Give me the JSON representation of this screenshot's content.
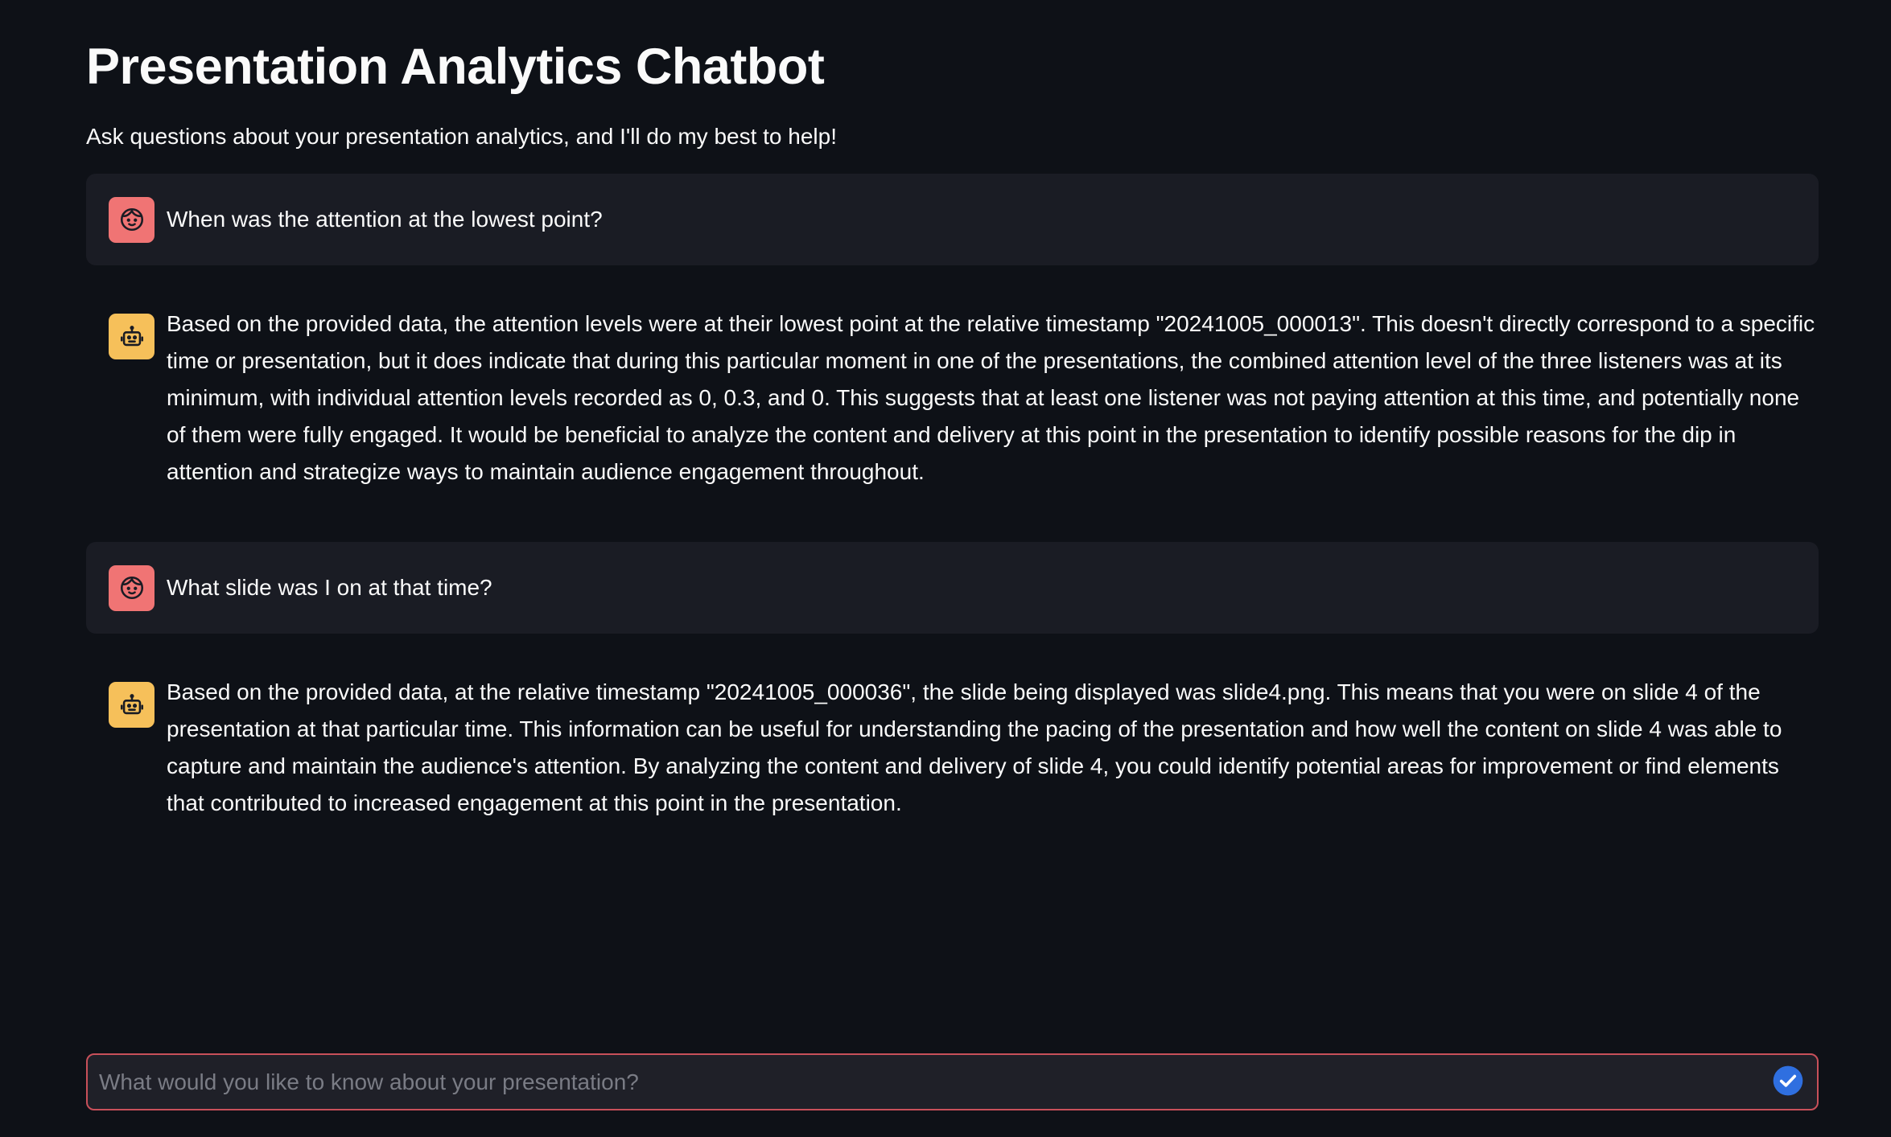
{
  "page": {
    "title": "Presentation Analytics Chatbot",
    "subtitle": "Ask questions about your presentation analytics, and I'll do my best to help!"
  },
  "messages": [
    {
      "role": "user",
      "avatar_icon": "user-face-icon",
      "text": "When was the attention at the lowest point?"
    },
    {
      "role": "assistant",
      "avatar_icon": "robot-icon",
      "text": "Based on the provided data, the attention levels were at their lowest point at the relative timestamp \"20241005_000013\". This doesn't directly correspond to a specific time or presentation, but it does indicate that during this particular moment in one of the presentations, the combined attention level of the three listeners was at its minimum, with individual attention levels recorded as 0, 0.3, and 0. This suggests that at least one listener was not paying attention at this time, and potentially none of them were fully engaged. It would be beneficial to analyze the content and delivery at this point in the presentation to identify possible reasons for the dip in attention and strategize ways to maintain audience engagement throughout."
    },
    {
      "role": "user",
      "avatar_icon": "user-face-icon",
      "text": "What slide was I on at that time?"
    },
    {
      "role": "assistant",
      "avatar_icon": "robot-icon",
      "text": "Based on the provided data, at the relative timestamp \"20241005_000036\", the slide being displayed was slide4.png. This means that you were on slide 4 of the presentation at that particular time. This information can be useful for understanding the pacing of the presentation and how well the content on slide 4 was able to capture and maintain the audience's attention. By analyzing the content and delivery of slide 4, you could identify potential areas for improvement or find elements that contributed to increased engagement at this point in the presentation."
    }
  ],
  "chat_input": {
    "placeholder": "What would you like to know about your presentation?",
    "value": "",
    "send_icon": "send-check-icon"
  },
  "colors": {
    "background": "#0e1117",
    "user_message_bg": "#1a1c24",
    "user_avatar": "#f07474",
    "assistant_avatar": "#f6c05a",
    "input_border": "#c8505a",
    "send_button": "#2f6fe0"
  }
}
